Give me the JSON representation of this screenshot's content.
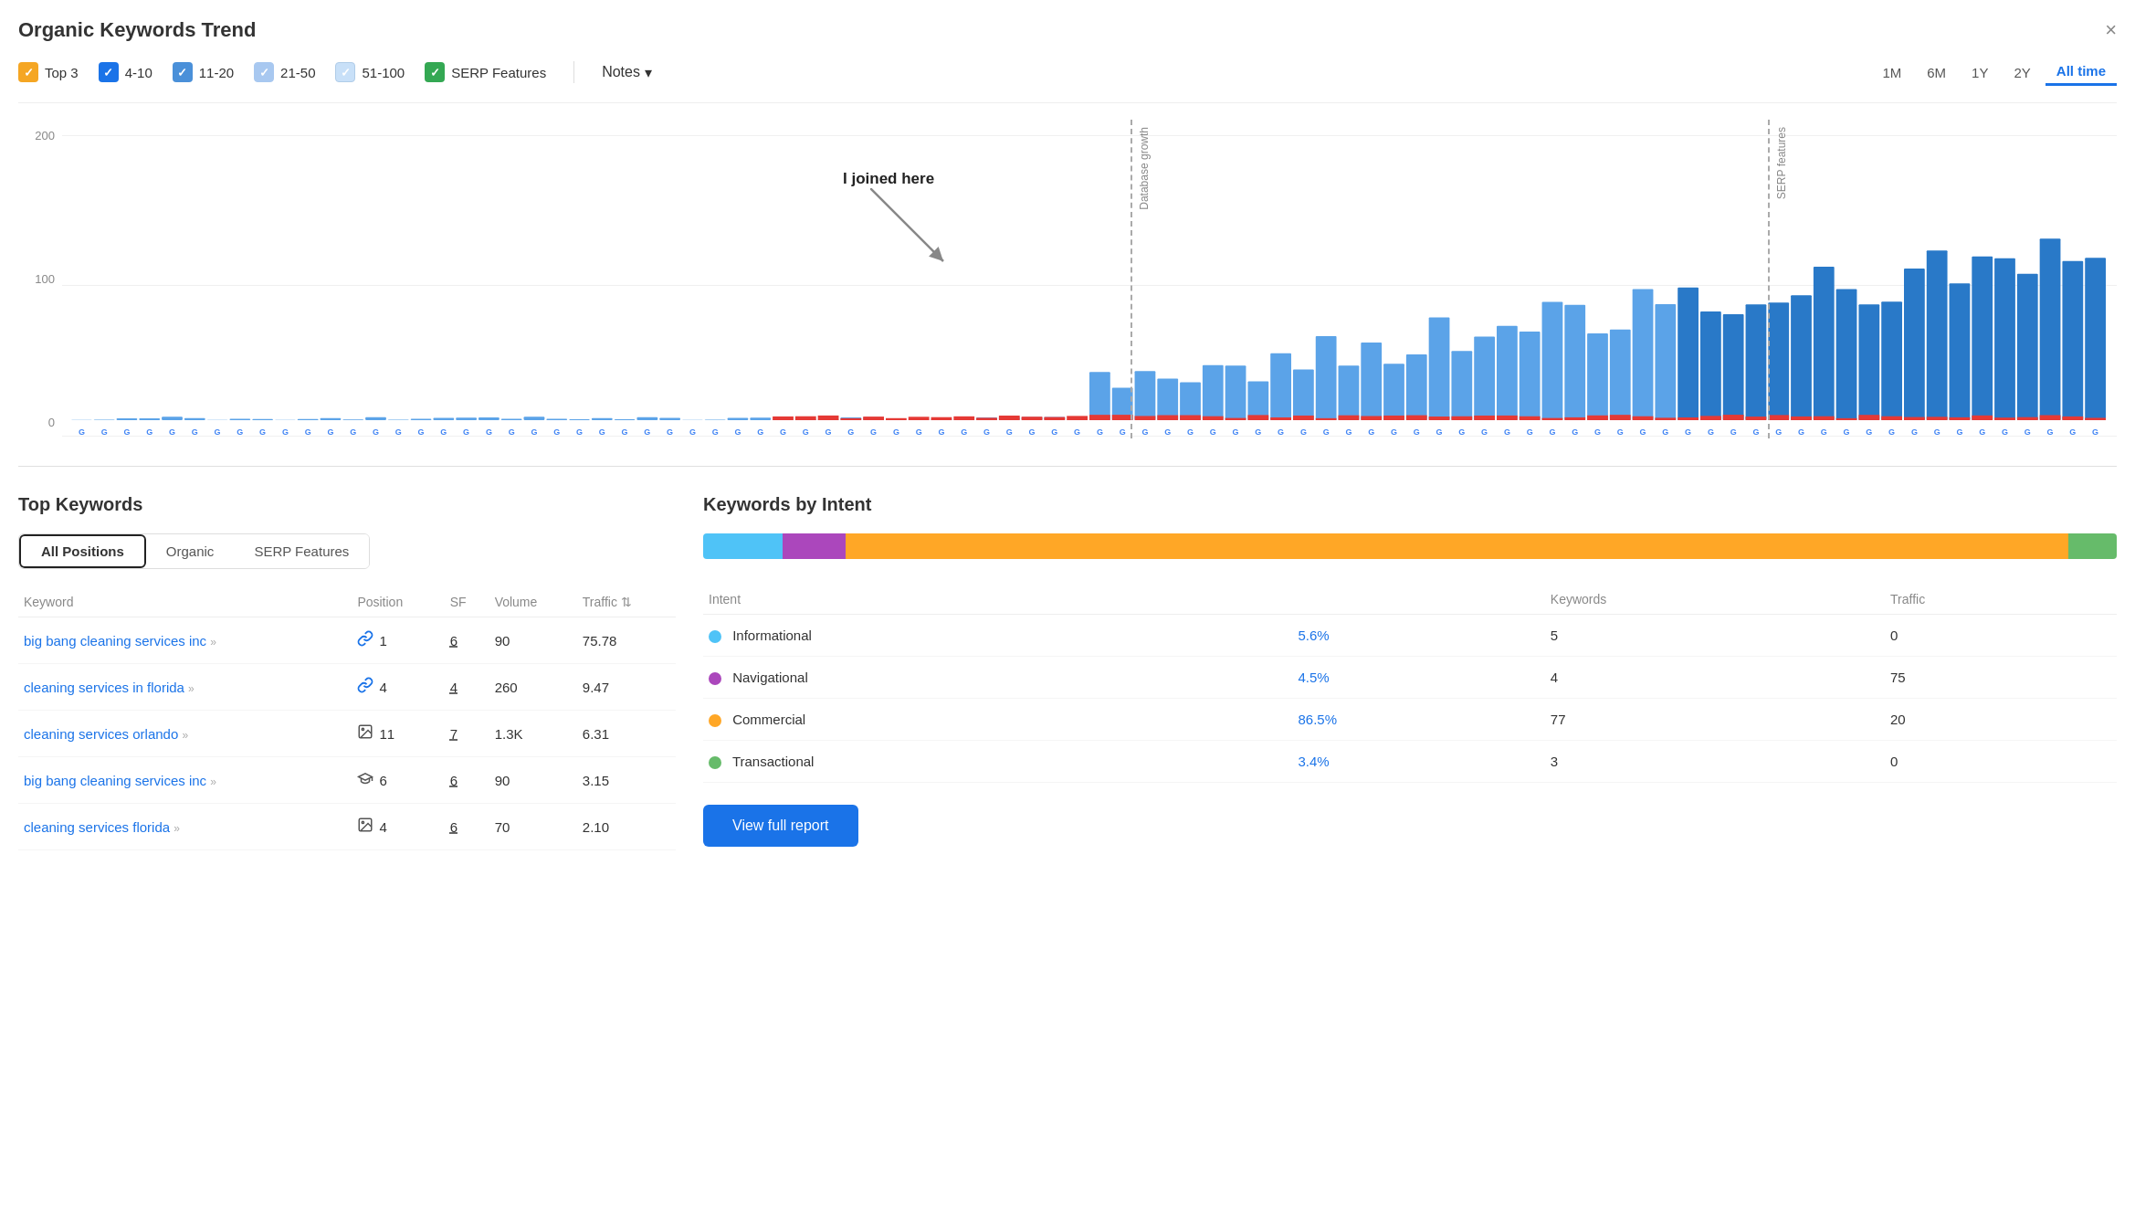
{
  "title": "Organic Keywords Trend",
  "close_btn": "×",
  "legend": {
    "items": [
      {
        "label": "Top 3",
        "color": "yellow",
        "check": "✓"
      },
      {
        "label": "4-10",
        "color": "blue-dark",
        "check": "✓"
      },
      {
        "label": "11-20",
        "color": "blue-mid",
        "check": "✓"
      },
      {
        "label": "21-50",
        "color": "blue-light",
        "check": "✓"
      },
      {
        "label": "51-100",
        "color": "light",
        "check": "✓"
      },
      {
        "label": "SERP Features",
        "color": "green",
        "check": "✓"
      }
    ],
    "notes_label": "Notes",
    "chevron": "▾"
  },
  "time_buttons": [
    "1M",
    "6M",
    "1Y",
    "2Y",
    "All time"
  ],
  "active_time": "All time",
  "chart": {
    "y_labels": [
      "200",
      "100",
      "0"
    ],
    "annotation": "I joined here",
    "vlines": [
      {
        "label": "Database growth"
      },
      {
        "label": "SERP features"
      }
    ]
  },
  "top_keywords": {
    "title": "Top Keywords",
    "tabs": [
      "All Positions",
      "Organic",
      "SERP Features"
    ],
    "active_tab": "All Positions",
    "columns": [
      "Keyword",
      "Position",
      "SF",
      "Volume",
      "Traffic"
    ],
    "rows": [
      {
        "keyword": "big bang cleaning services inc",
        "position": "1",
        "pos_icon": "link",
        "sf": "6",
        "volume": "90",
        "traffic": "75.78"
      },
      {
        "keyword": "cleaning services in florida",
        "position": "4",
        "pos_icon": "link",
        "sf": "4",
        "volume": "260",
        "traffic": "9.47"
      },
      {
        "keyword": "cleaning services orlando",
        "position": "11",
        "pos_icon": "image",
        "sf": "7",
        "volume": "1.3K",
        "traffic": "6.31"
      },
      {
        "keyword": "big bang cleaning services inc",
        "position": "6",
        "pos_icon": "academic",
        "sf": "6",
        "volume": "90",
        "traffic": "3.15"
      },
      {
        "keyword": "cleaning services florida",
        "position": "4",
        "pos_icon": "image",
        "sf": "6",
        "volume": "70",
        "traffic": "2.10"
      }
    ]
  },
  "keywords_by_intent": {
    "title": "Keywords by Intent",
    "bar_segments": [
      {
        "type": "Informational",
        "color": "#4fc3f7",
        "pct": 5.6
      },
      {
        "type": "Navigational",
        "color": "#ab47bc",
        "pct": 4.5
      },
      {
        "type": "Commercial",
        "color": "#ffa726",
        "pct": 86.5
      },
      {
        "type": "Transactional",
        "color": "#66bb6a",
        "pct": 3.4
      }
    ],
    "columns": [
      "Intent",
      "",
      "Keywords",
      "Traffic"
    ],
    "rows": [
      {
        "intent": "Informational",
        "color": "#4fc3f7",
        "pct": "5.6%",
        "keywords": "5",
        "traffic": "0"
      },
      {
        "intent": "Navigational",
        "color": "#ab47bc",
        "pct": "4.5%",
        "keywords": "4",
        "traffic": "75"
      },
      {
        "intent": "Commercial",
        "color": "#ffa726",
        "pct": "86.5%",
        "keywords": "77",
        "traffic": "20"
      },
      {
        "intent": "Transactional",
        "color": "#66bb6a",
        "pct": "3.4%",
        "keywords": "3",
        "traffic": "0"
      }
    ],
    "view_full_label": "View full report"
  }
}
